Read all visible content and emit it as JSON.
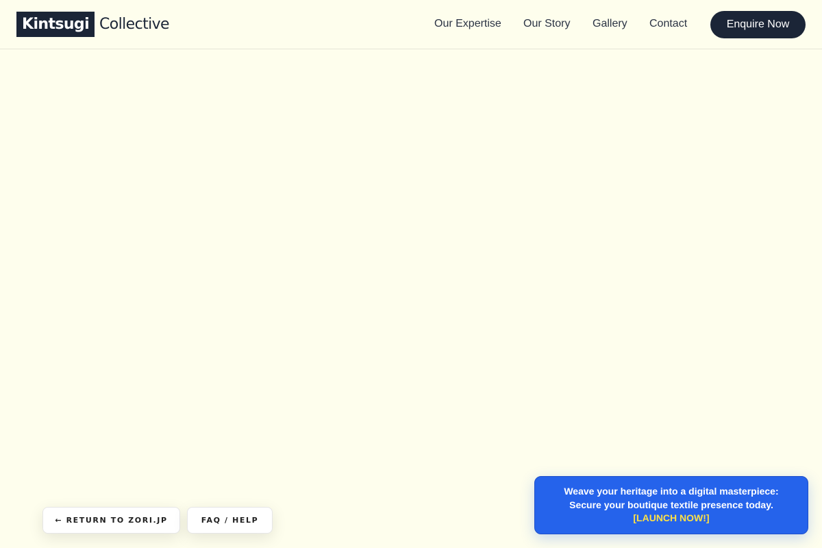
{
  "header": {
    "logo": {
      "boxed": "Kintsugi",
      "text": "Collective"
    },
    "nav": [
      {
        "label": "Our Expertise"
      },
      {
        "label": "Our Story"
      },
      {
        "label": "Gallery"
      },
      {
        "label": "Contact"
      }
    ],
    "cta_label": "Enquire Now"
  },
  "floating": {
    "return_label": "← RETURN TO ZORI.JP",
    "faq_label": "FAQ / HELP"
  },
  "promo": {
    "line1": "Weave your heritage into a digital masterpiece:",
    "line2": "Secure your boutique textile presence today.",
    "cta": "[LAUNCH NOW!]"
  },
  "colors": {
    "page_background": "#fefeed",
    "navy": "#1b2537",
    "promo_blue": "#2563eb",
    "promo_cta_yellow": "#fde047"
  }
}
